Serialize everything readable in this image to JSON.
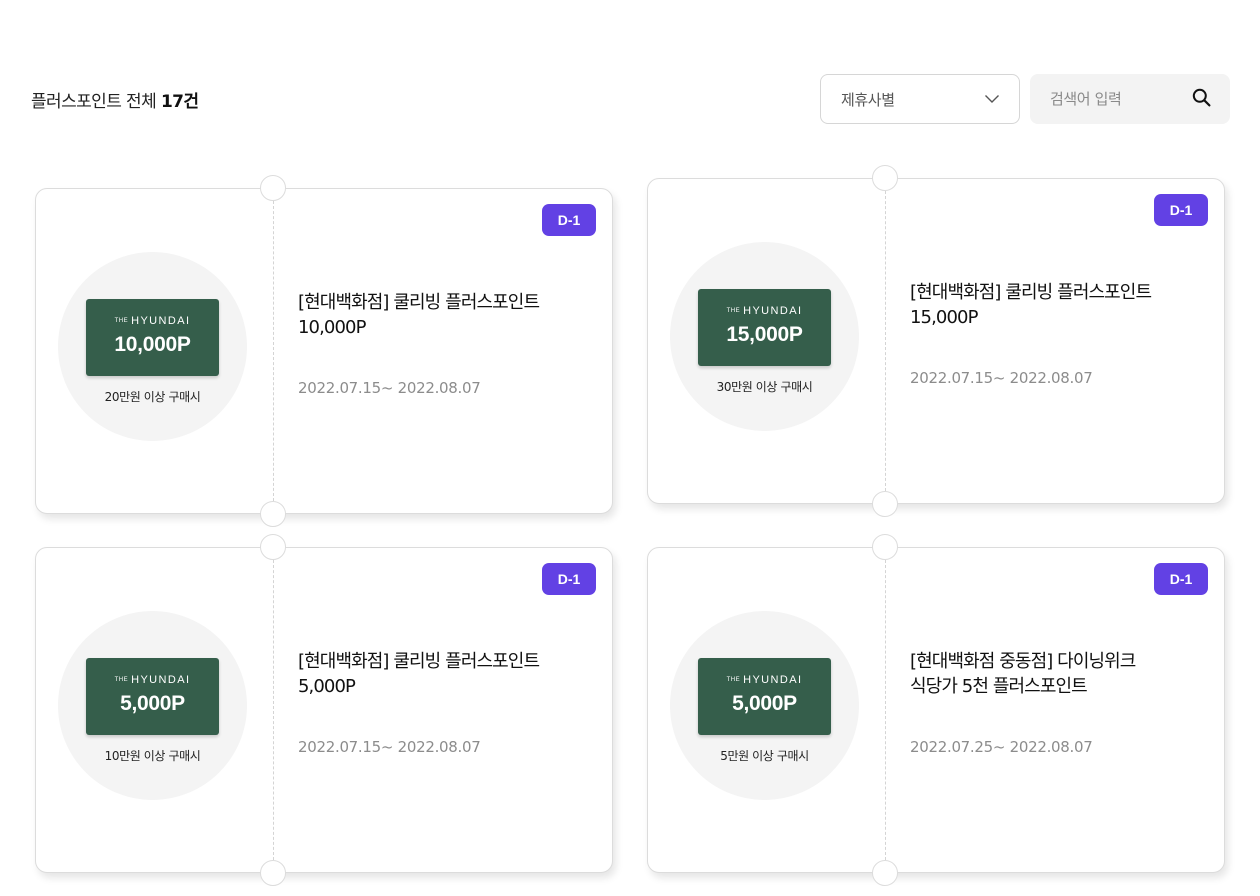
{
  "header": {
    "count_prefix": "플러스포인트 전체",
    "count_value": "17건"
  },
  "filter": {
    "selected": "제휴사별",
    "icon": "chevron-down-icon"
  },
  "search": {
    "placeholder": "검색어 입력",
    "icon": "search-icon"
  },
  "colors": {
    "accent": "#6241e4",
    "card_green": "#355e4b"
  },
  "coupons": [
    {
      "badge": "D-1",
      "brand_small": "THE",
      "brand": "HYUNDAI",
      "card_amount": "10,000P",
      "condition": "20만원 이상 구매시",
      "title_line1": "[현대백화점] 쿨리빙 플러스포인트",
      "title_line2": "10,000P",
      "period": "2022.07.15~ 2022.08.07"
    },
    {
      "badge": "D-1",
      "brand_small": "THE",
      "brand": "HYUNDAI",
      "card_amount": "15,000P",
      "condition": "30만원 이상 구매시",
      "title_line1": "[현대백화점] 쿨리빙 플러스포인트",
      "title_line2": "15,000P",
      "period": "2022.07.15~ 2022.08.07"
    },
    {
      "badge": "D-1",
      "brand_small": "THE",
      "brand": "HYUNDAI",
      "card_amount": "5,000P",
      "condition": "10만원 이상 구매시",
      "title_line1": "[현대백화점] 쿨리빙 플러스포인트",
      "title_line2": "5,000P",
      "period": "2022.07.15~ 2022.08.07"
    },
    {
      "badge": "D-1",
      "brand_small": "THE",
      "brand": "HYUNDAI",
      "card_amount": "5,000P",
      "condition": "5만원 이상 구매시",
      "title_line1": "[현대백화점 중동점] 다이닝위크",
      "title_line2": "식당가 5천 플러스포인트",
      "period": "2022.07.25~ 2022.08.07"
    }
  ]
}
